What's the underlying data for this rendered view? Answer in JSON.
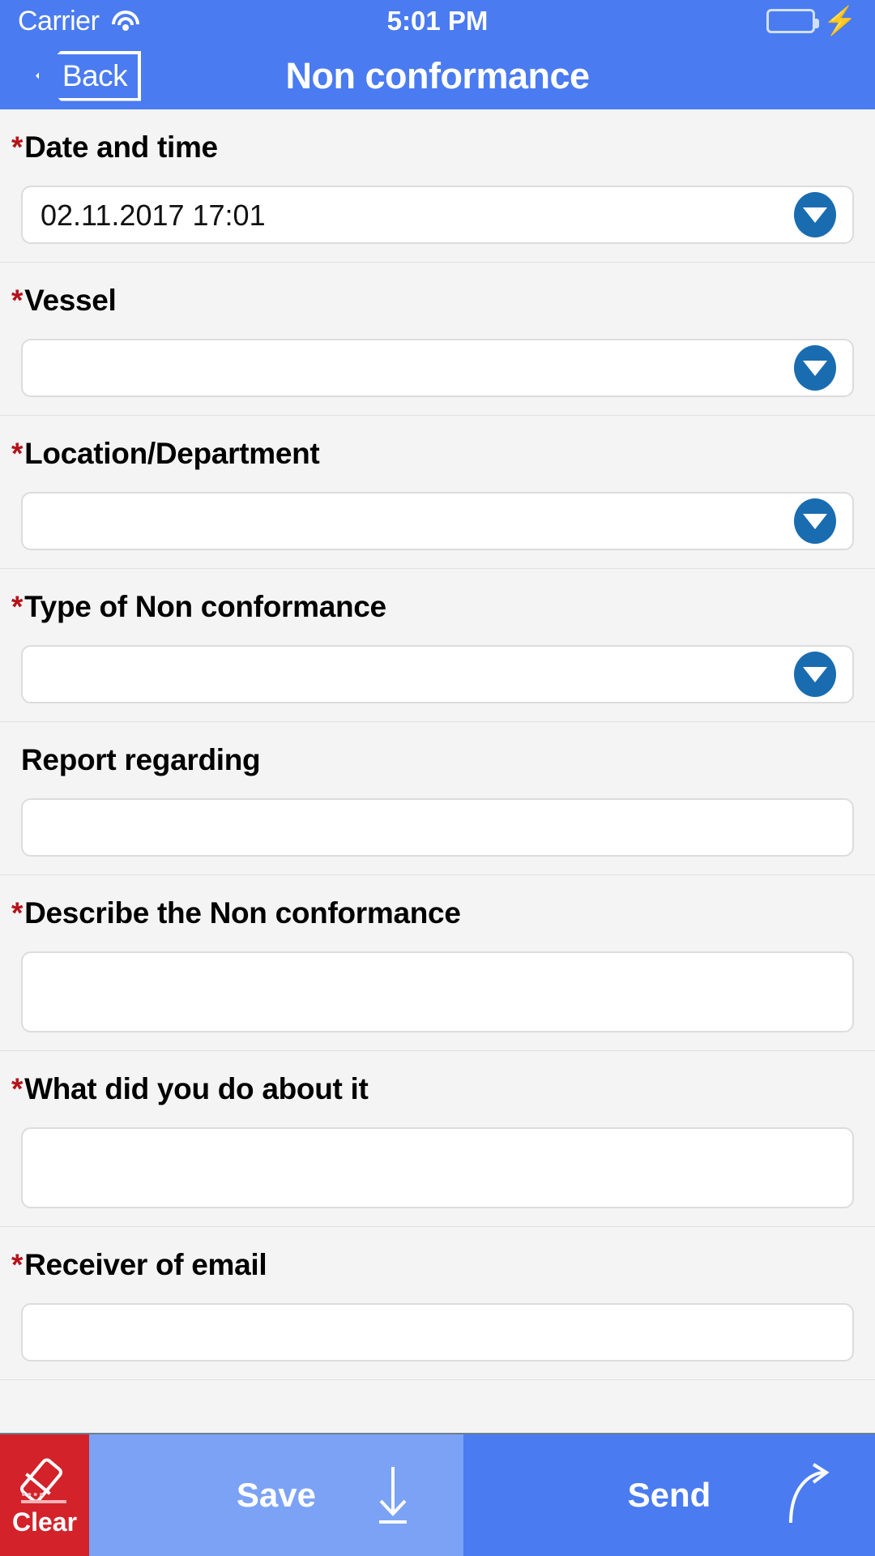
{
  "status_bar": {
    "carrier": "Carrier",
    "time": "5:01 PM",
    "wifi_icon": "wifi-icon",
    "battery_icon": "battery-icon",
    "charging_icon": "lightning-bolt-icon"
  },
  "nav_bar": {
    "back_label": "Back",
    "title": "Non conformance"
  },
  "form": {
    "fields": [
      {
        "label": "Date and time",
        "required": true,
        "type": "dropdown",
        "value": "02.11.2017 17:01",
        "name": "date-and-time"
      },
      {
        "label": "Vessel",
        "required": true,
        "type": "dropdown",
        "value": "",
        "name": "vessel"
      },
      {
        "label": "Location/Department",
        "required": true,
        "type": "dropdown",
        "value": "",
        "name": "location-department"
      },
      {
        "label": "Type of Non conformance",
        "required": true,
        "type": "dropdown",
        "value": "",
        "name": "type-of-non-conformance"
      },
      {
        "label": "Report regarding",
        "required": false,
        "type": "text",
        "value": "",
        "name": "report-regarding"
      },
      {
        "label": "Describe the Non conformance",
        "required": true,
        "type": "textarea",
        "value": "",
        "name": "describe-the-non-conformance"
      },
      {
        "label": "What did you do about it",
        "required": true,
        "type": "textarea",
        "value": "",
        "name": "what-did-you-do-about-it"
      },
      {
        "label": "Receiver of email",
        "required": true,
        "type": "text",
        "value": "",
        "name": "receiver-of-email"
      }
    ],
    "required_marker": "*"
  },
  "toolbar": {
    "clear_label": "Clear",
    "clear_icon": "eraser-icon",
    "save_label": "Save",
    "save_icon": "download-arrow-icon",
    "send_label": "Send",
    "send_icon": "curved-arrow-icon"
  },
  "colors": {
    "nav_blue": "#4a7bf0",
    "save_blue": "#7ba2f5",
    "send_blue": "#4a7bf0",
    "clear_red": "#d3222a",
    "dropdown_blue": "#1a6cb0",
    "required_star": "#b5121b",
    "page_background": "#f4f4f4"
  }
}
